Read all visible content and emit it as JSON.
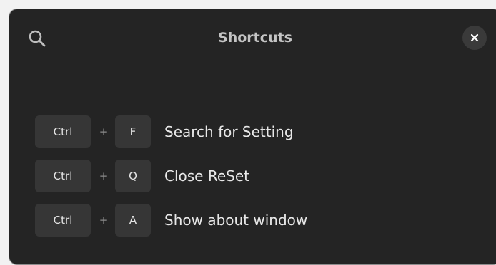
{
  "window": {
    "title": "Shortcuts",
    "search_icon": "search-icon",
    "close_icon": "close-icon"
  },
  "shortcuts": [
    {
      "modifier": "Ctrl",
      "plus": "+",
      "key": "F",
      "description": "Search for Setting"
    },
    {
      "modifier": "Ctrl",
      "plus": "+",
      "key": "Q",
      "description": "Close ReSet"
    },
    {
      "modifier": "Ctrl",
      "plus": "+",
      "key": "A",
      "description": "Show about window"
    }
  ],
  "colors": {
    "window_background": "#242424",
    "key_background": "#363636",
    "title_text": "#c4c4c4",
    "description_text": "#e8e8e8"
  }
}
